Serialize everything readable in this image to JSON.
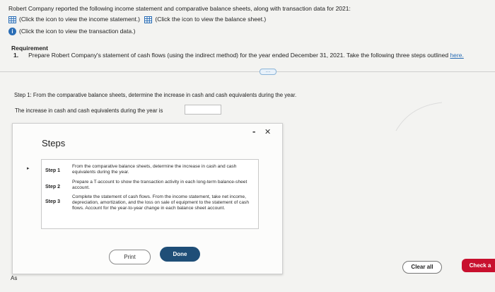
{
  "header": {
    "intro": "Robert Company reported the following income statement and comparative balance sheets, along with transaction data for 2021:",
    "income_link": "(Click the icon to view the income statement.)",
    "balance_link": "(Click the icon to view the balance sheet.)",
    "transaction_link": "(Click the icon to view the transaction data.)"
  },
  "requirement": {
    "heading": "Requirement",
    "number": "1.",
    "text": "Prepare Robert Company's statement of cash flows (using the indirect method) for the year ended December 31, 2021. Take the following three steps outlined",
    "here_link": "here.",
    "collapse_pill": "....."
  },
  "step1": {
    "instruction": "Step 1: From the comparative balance sheets, determine the increase in cash and cash equivalents during the year.",
    "prompt": "The increase in cash and cash equivalents during the year is",
    "answer_value": ""
  },
  "modal": {
    "title": "Steps",
    "minimize": "-",
    "close": "✕",
    "steps": [
      {
        "label": "Step 1",
        "text": "From the comparative balance sheets, determine the increase in cash and cash equivalents during the year."
      },
      {
        "label": "Step 2",
        "text": "Prepare a T-account to show the transaction activity in each long-term balance-sheet account."
      },
      {
        "label": "Step 3",
        "text": "Complete the statement of cash flows. From the income statement, take net income, depreciation, amortization, and the loss on sale of equipment to the statement of cash flows. Account for the year-to-year change in each balance sheet account."
      }
    ],
    "print_label": "Print",
    "done_label": "Done"
  },
  "footer": {
    "partial_text": "As",
    "clear_label": "Clear all",
    "check_label": "Check a"
  },
  "colors": {
    "done": "#1f4e77",
    "check": "#c8102e",
    "link": "#2a6db5"
  }
}
